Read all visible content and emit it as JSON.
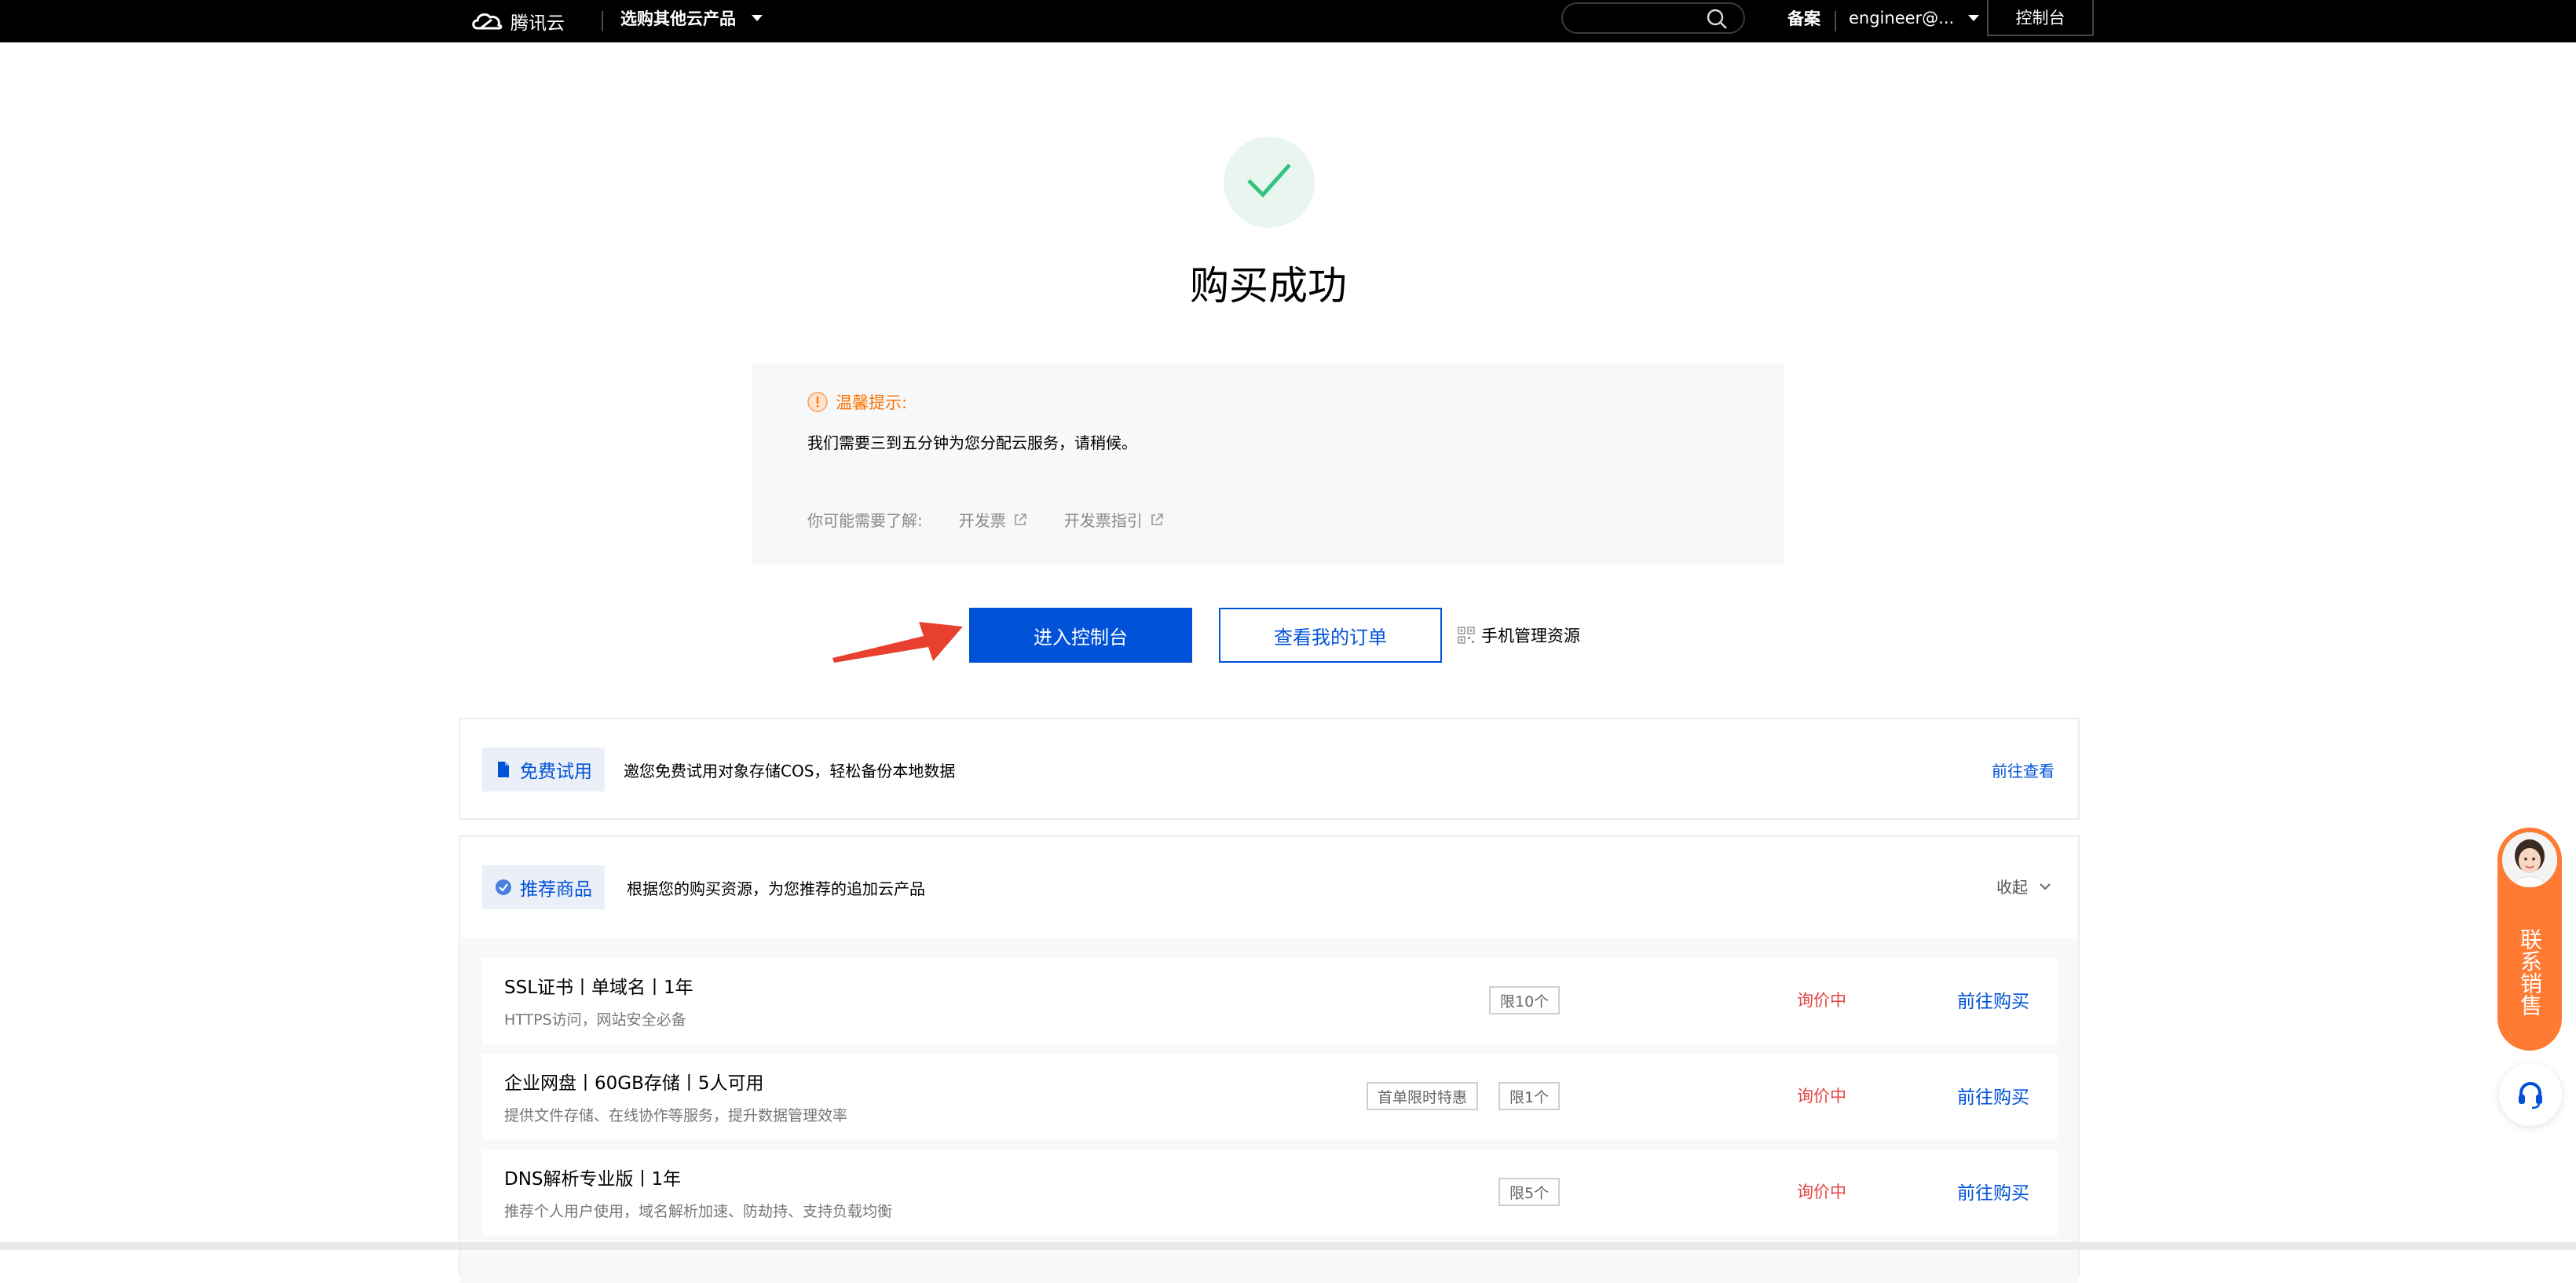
{
  "header": {
    "logo_text": "腾讯云",
    "product_menu_label": "选购其他云产品",
    "search_placeholder": "",
    "beian_label": "备案",
    "account_label": "engineer@...",
    "console_label": "控制台"
  },
  "success": {
    "title": "购买成功",
    "icon": "check-icon"
  },
  "tips": {
    "heading": "温馨提示:",
    "message": "我们需要三到五分钟为您分配云服务，请稍候。",
    "links_prefix": "你可能需要了解:",
    "links": [
      {
        "label": "开发票"
      },
      {
        "label": "开发票指引"
      }
    ]
  },
  "actions": {
    "enter_console": "进入控制台",
    "view_orders": "查看我的订单",
    "mobile_manage": "手机管理资源"
  },
  "free_trial": {
    "tag": "免费试用",
    "description": "邀您免费试用对象存储COS，轻松备份本地数据",
    "link": "前往查看"
  },
  "recommend": {
    "tag": "推荐商品",
    "description": "根据您的购买资源，为您推荐的追加云产品",
    "collapse_label": "收起",
    "items": [
      {
        "name": "SSL证书丨单域名丨1年",
        "desc": "HTTPS访问，网站安全必备",
        "badges": [
          "限10个"
        ],
        "status": "询价中",
        "action": "前往购买"
      },
      {
        "name": "企业网盘丨60GB存储丨5人可用",
        "desc": "提供文件存储、在线协作等服务，提升数据管理效率",
        "badges": [
          "首单限时特惠",
          "限1个"
        ],
        "status": "询价中",
        "action": "前往购买"
      },
      {
        "name": "DNS解析专业版丨1年",
        "desc": "推荐个人用户使用，域名解析加速、防劫持、支持负载均衡",
        "badges": [
          "限5个"
        ],
        "status": "询价中",
        "action": "前往购买"
      }
    ]
  },
  "sales_widget": {
    "label": "联系销售"
  },
  "colors": {
    "primary": "#0052d9",
    "warning": "#ff7200",
    "danger": "#e54545",
    "success_bg": "#e8f6ef",
    "success": "#34c37f",
    "sales": "#ff7a33"
  }
}
